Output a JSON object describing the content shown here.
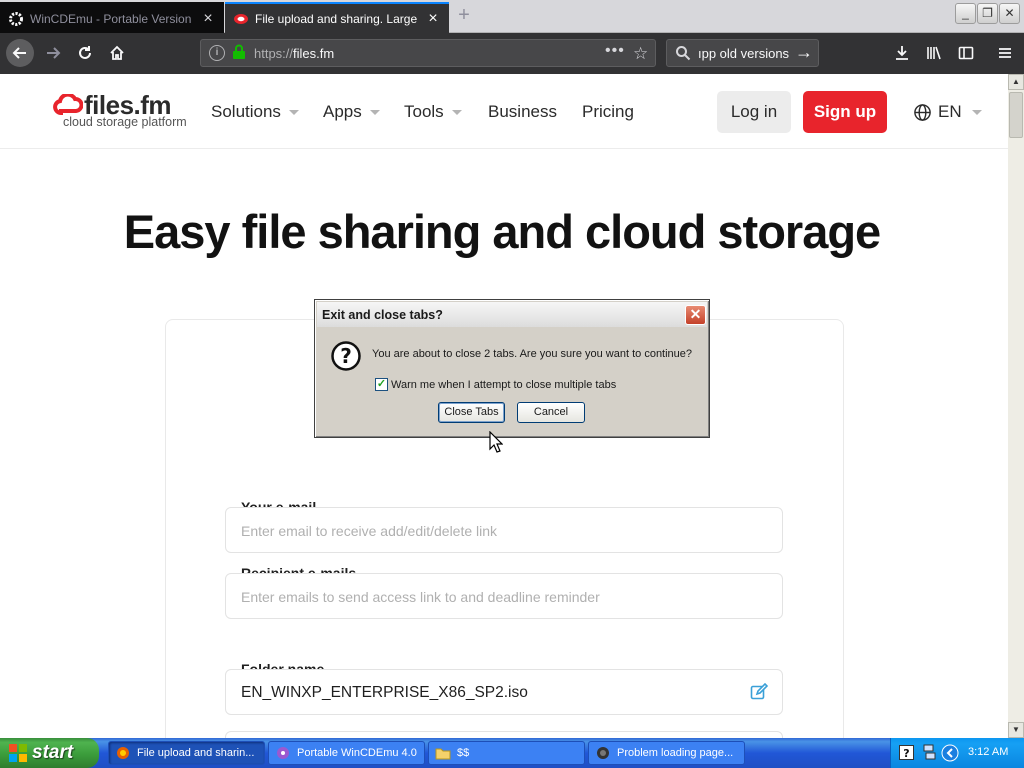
{
  "browser": {
    "tabs": [
      {
        "title": "WinCDEmu - Portable Version (Run",
        "active": false
      },
      {
        "title": "File upload and sharing. Large file",
        "active": true
      }
    ],
    "address": {
      "prefix": "https://",
      "host": "files.fm"
    },
    "search_text": "ıpp old versions",
    "window_buttons": [
      "_",
      "❐",
      "✕"
    ]
  },
  "site": {
    "logo_name": "files.fm",
    "logo_tagline": "cloud storage platform",
    "nav": [
      {
        "label": "Solutions",
        "dropdown": true
      },
      {
        "label": "Apps",
        "dropdown": true
      },
      {
        "label": "Tools",
        "dropdown": true
      },
      {
        "label": "Business",
        "dropdown": false
      },
      {
        "label": "Pricing",
        "dropdown": false
      }
    ],
    "login_label": "Log in",
    "signup_label": "Sign up",
    "language": "EN",
    "headline": "Easy file sharing and cloud storage",
    "form": {
      "email_label": "Your e-mail",
      "email_placeholder": "Enter email to receive add/edit/delete link",
      "recipients_label": "Recipient e-mails",
      "recipients_placeholder": "Enter emails to send access link to and deadline reminder",
      "folder_label": "Folder name",
      "folder_value": "EN_WINXP_ENTERPRISE_X86_SP2.iso"
    },
    "colors": {
      "brand_red": "#e8242c",
      "edit_icon": "#3aa0d8"
    }
  },
  "dialog": {
    "title": "Exit and close tabs?",
    "message": "You are about to close 2 tabs. Are you sure you want to continue?",
    "checkbox_label": "Warn me when I attempt to close multiple tabs",
    "checkbox_checked": true,
    "confirm_label": "Close Tabs",
    "cancel_label": "Cancel",
    "icon": "question-icon"
  },
  "taskbar": {
    "start_label": "start",
    "tasks": [
      {
        "label": "File upload and sharin...",
        "icon": "firefox-icon",
        "active": true
      },
      {
        "label": "Portable WinCDEmu 4.0",
        "icon": "wincdemu-icon",
        "active": false
      },
      {
        "label": "$$",
        "icon": "folder-icon",
        "active": false
      },
      {
        "label": "Problem loading page...",
        "icon": "browser-icon",
        "active": false
      }
    ],
    "clock": "3:12 AM"
  }
}
